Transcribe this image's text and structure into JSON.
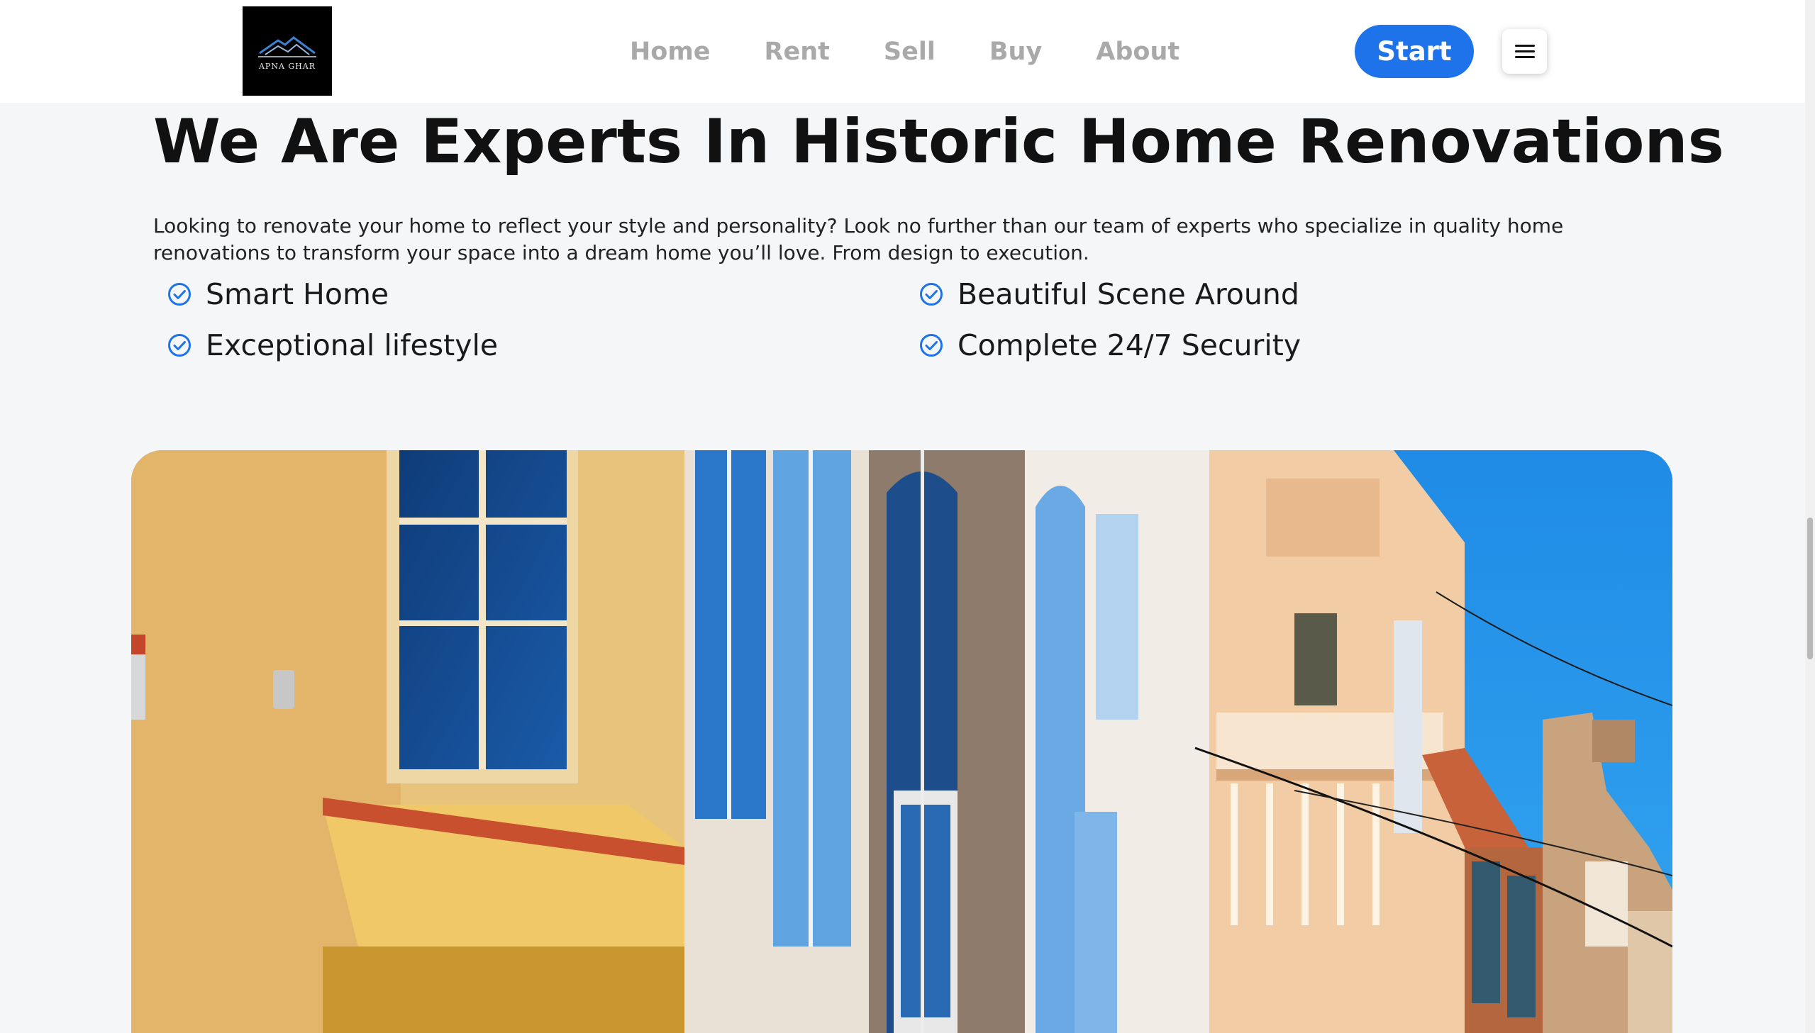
{
  "header": {
    "logo_text": "APNA GHAR",
    "nav": [
      "Home",
      "Rent",
      "Sell",
      "Buy",
      "About"
    ],
    "start_label": "Start"
  },
  "main": {
    "title": "We Are Experts In Historic Home Renovations",
    "description": "Looking to renovate your home to reflect your style and personality? Look no further than our team of experts who specialize in quality home renovations to transform your space into a dream home you’ll love. From design to execution.",
    "features": [
      "Smart Home",
      "Beautiful Scene Around",
      "Exceptional lifestyle",
      "Complete 24/7 Security"
    ]
  },
  "colors": {
    "accent": "#1f73ea",
    "nav_text": "#a9a9a9",
    "page_bg": "#f4f6f8"
  },
  "icons": {
    "feature": "check-circle-icon",
    "menu": "hamburger-icon"
  }
}
